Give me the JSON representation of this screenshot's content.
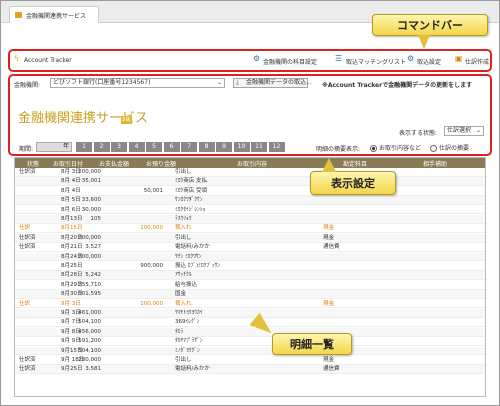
{
  "tab": {
    "title": "金融機関連携サービス"
  },
  "command_bar": {
    "app_name": "Account Tracker",
    "items": [
      {
        "label": "金融機関の科目設定",
        "icon": "gear-icon"
      },
      {
        "label": "取込マッチングリスト",
        "icon": "list-icon"
      },
      {
        "label": "取込設定",
        "icon": "gear-icon"
      },
      {
        "label": "仕訳作成",
        "icon": "document-icon"
      }
    ]
  },
  "settings": {
    "institution_label": "金融機関:",
    "institution_value": "どびソフト銀行(口座番号1234567)",
    "import_button": "金融機関データの取込...",
    "notice": "※Account Trackerで金融機関データの更新をします",
    "service_title": "金融機関連携サービス",
    "badge": "β版",
    "display_state_label": "表示する状態:",
    "display_state_value": "仕訳選択",
    "period_label": "期間:",
    "year_value": "年",
    "months": [
      "1",
      "2",
      "3",
      "4",
      "5",
      "6",
      "7",
      "8",
      "9",
      "10",
      "11",
      "12"
    ],
    "detail_label": "明細の摘要表示:",
    "detail_options": [
      "お取引内容など",
      "仕訳の摘要"
    ]
  },
  "table": {
    "headers": [
      "状態",
      "お取引日付",
      "お支払金額",
      "お預り金額",
      "お取引内容",
      "勘定科目",
      "相手補助"
    ],
    "rows": [
      {
        "status": "仕訳済",
        "date": "8月 3日",
        "pay": "200,000",
        "deposit": "",
        "content": "引出し",
        "account": "",
        "sub": "",
        "orange": false
      },
      {
        "status": "",
        "date": "8月 4日",
        "pay": "35,001",
        "deposit": "",
        "content": "ﾐﾛｸ商店 支払",
        "account": "",
        "sub": "",
        "orange": false
      },
      {
        "status": "",
        "date": "8月 4日",
        "pay": "",
        "deposit": "50,001",
        "content": "ﾐﾛｸ商店 受領",
        "account": "",
        "sub": "",
        "orange": false
      },
      {
        "status": "",
        "date": "8月 5日",
        "pay": "33,600",
        "deposit": "",
        "content": "ｻﾝﾛｸﾜﾀﾞｸｻﾝ",
        "account": "",
        "sub": "",
        "orange": false
      },
      {
        "status": "",
        "date": "8月 6日",
        "pay": "30,000",
        "deposit": "",
        "content": "ﾐﾛｸｾｲｼﾞｼﾝｼｮ",
        "account": "",
        "sub": "",
        "orange": false
      },
      {
        "status": "",
        "date": "8月13日",
        "pay": "105",
        "deposit": "",
        "content": "ﾃｽｳﾘｮｳ",
        "account": "",
        "sub": "",
        "orange": false
      },
      {
        "status": "仕訳",
        "date": "8月15日",
        "pay": "",
        "deposit": "100,000",
        "content": "預入れ",
        "account": "現金",
        "sub": "",
        "orange": true
      },
      {
        "status": "仕訳済",
        "date": "8月20日",
        "pay": "200,000",
        "deposit": "",
        "content": "引出し",
        "account": "現金",
        "sub": "",
        "orange": false
      },
      {
        "status": "仕訳済",
        "date": "8月21日",
        "pay": "3,527",
        "deposit": "",
        "content": "電話料/みかか",
        "account": "通信費",
        "sub": "",
        "orange": false
      },
      {
        "status": "",
        "date": "8月24日",
        "pay": "200,000",
        "deposit": "",
        "content": "ﾔﾁﾝ ﾐﾛｸﾜｻﾝ",
        "account": "",
        "sub": "",
        "orange": false
      },
      {
        "status": "",
        "date": "8月25日",
        "pay": "",
        "deposit": "900,000",
        "content": "振込 ｶﾌﾞ)ﾐﾛｸﾌﾞｯｻﾝ",
        "account": "",
        "sub": "",
        "orange": false
      },
      {
        "status": "",
        "date": "8月28日",
        "pay": "5,242",
        "deposit": "",
        "content": "ｱｻｯﾁｸﾙ",
        "account": "",
        "sub": "",
        "orange": false
      },
      {
        "status": "",
        "date": "8月29日",
        "pay": "255,710",
        "deposit": "",
        "content": "給与振込",
        "account": "",
        "sub": "",
        "orange": false
      },
      {
        "status": "",
        "date": "8月30日",
        "pay": "101,595",
        "deposit": "",
        "content": "国金",
        "account": "",
        "sub": "",
        "orange": false
      },
      {
        "status": "仕訳",
        "date": "9月 3日",
        "pay": "",
        "deposit": "100,000",
        "content": "預入れ",
        "account": "現金",
        "sub": "",
        "orange": true
      },
      {
        "status": "",
        "date": "9月 3日",
        "pay": "461,000",
        "deposit": "",
        "content": "ﾔﾏﾓﾄﾖｳﾖｳｶｲ",
        "account": "",
        "sub": "",
        "orange": false
      },
      {
        "status": "",
        "date": "9月 7日",
        "pay": "504,100",
        "deposit": "",
        "content": "369ｲﾚｸﾞﾝ",
        "account": "",
        "sub": "",
        "orange": false
      },
      {
        "status": "",
        "date": "9月 8日",
        "pay": "456,000",
        "deposit": "",
        "content": "ﾀｶﾗ",
        "account": "",
        "sub": "",
        "orange": false
      },
      {
        "status": "",
        "date": "9月 9日",
        "pay": "591,200",
        "deposit": "",
        "content": "ﾀｶﾔﾏﾌﾟﾗｻﾞﾝ",
        "account": "",
        "sub": "",
        "orange": false
      },
      {
        "status": "",
        "date": "9月15日",
        "pay": "504,100",
        "deposit": "",
        "content": "ﾐﾉﾀﾞﾖｳｸﾞﾝ",
        "account": "",
        "sub": "",
        "orange": false
      },
      {
        "status": "仕訳済",
        "date": "9月 18日",
        "pay": "200,000",
        "deposit": "",
        "content": "引出し",
        "account": "現金",
        "sub": "",
        "orange": false
      },
      {
        "status": "仕訳済",
        "date": "9月25日",
        "pay": "3,581",
        "deposit": "",
        "content": "電話料/みかか",
        "account": "通信費",
        "sub": "",
        "orange": false
      }
    ]
  },
  "callouts": {
    "command": "コマンドバー",
    "display": "表示設定",
    "detail": "明細一覧"
  },
  "colors": {
    "accent_red": "#e02020",
    "header_bg": "#8a7a55",
    "callout": "#f2d64a",
    "orange": "#e08010"
  }
}
